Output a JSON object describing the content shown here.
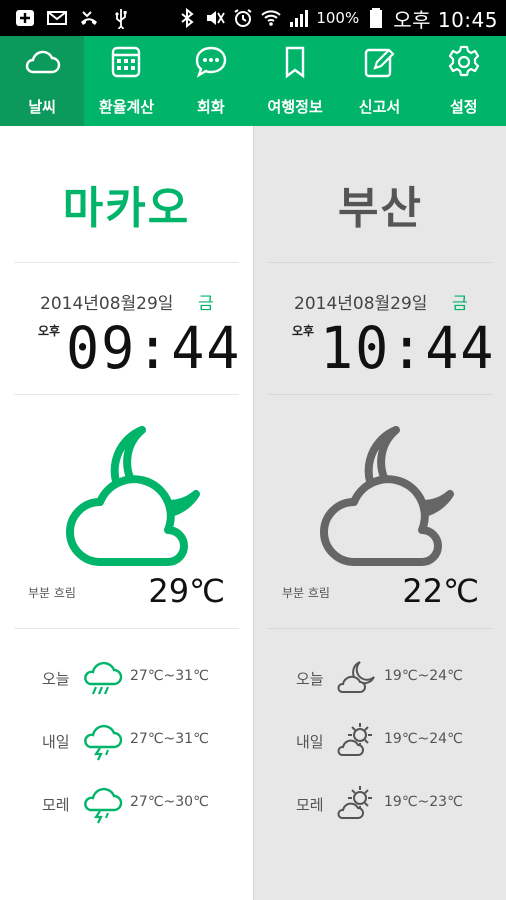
{
  "statusbar": {
    "icons_left": [
      "plus-box-icon",
      "mail-icon",
      "missed-call-icon",
      "usb-icon"
    ],
    "icons_right": [
      "bluetooth-icon",
      "mute-icon",
      "alarm-icon",
      "wifi-icon",
      "signal-icon"
    ],
    "battery": "100%",
    "time": "오후 10:45"
  },
  "tabs": [
    {
      "label": "날씨",
      "icon": "cloud-icon"
    },
    {
      "label": "환율계산",
      "icon": "calculator-icon"
    },
    {
      "label": "회화",
      "icon": "chat-bubble-icon"
    },
    {
      "label": "여행정보",
      "icon": "bookmark-icon"
    },
    {
      "label": "신고서",
      "icon": "pencil-icon"
    },
    {
      "label": "설정",
      "icon": "gear-icon"
    }
  ],
  "colors": {
    "accent": "#00b46a",
    "accent_dark": "#0c9a5c",
    "gray_icon": "#666666"
  },
  "cities": [
    {
      "name": "마카오",
      "date": "2014년08월29일",
      "weekday": "금",
      "ampm": "오후",
      "time": "09:44",
      "condition": "부분 흐림",
      "temperature": "29℃",
      "forecast": [
        {
          "day": "오늘",
          "icon": "cloud-rain-icon",
          "range": "27℃~31℃"
        },
        {
          "day": "내일",
          "icon": "cloud-thunder-icon",
          "range": "27℃~31℃"
        },
        {
          "day": "모레",
          "icon": "cloud-thunder-icon",
          "range": "27℃~30℃"
        }
      ]
    },
    {
      "name": "부산",
      "date": "2014년08월29일",
      "weekday": "금",
      "ampm": "오후",
      "time": "10:44",
      "condition": "부분 흐림",
      "temperature": "22℃",
      "forecast": [
        {
          "day": "오늘",
          "icon": "cloud-moon-icon",
          "range": "19℃~24℃"
        },
        {
          "day": "내일",
          "icon": "cloud-sun-icon",
          "range": "19℃~24℃"
        },
        {
          "day": "모레",
          "icon": "cloud-sun-icon",
          "range": "19℃~23℃"
        }
      ]
    }
  ]
}
